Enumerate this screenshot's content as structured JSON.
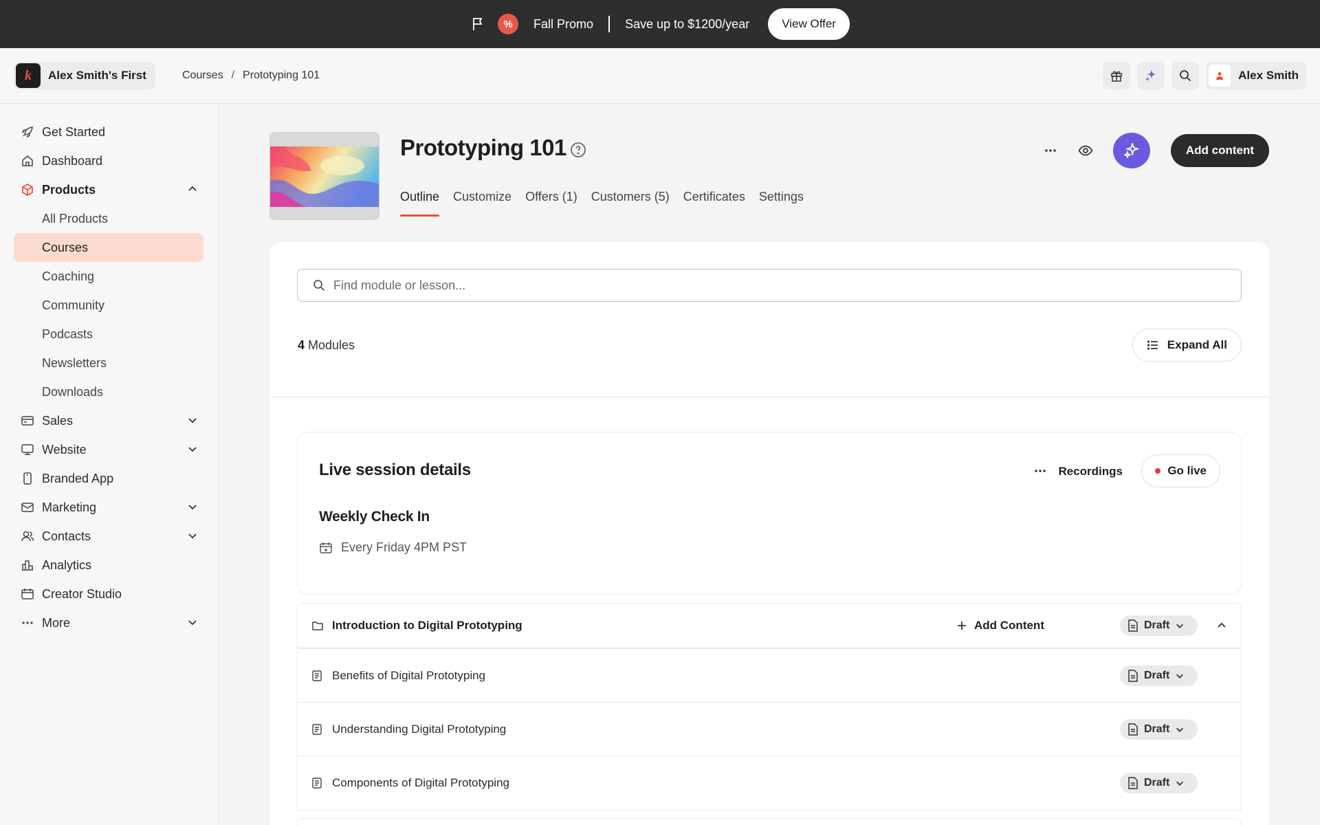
{
  "promo": {
    "title": "Fall Promo",
    "message": "Save up to $1200/year",
    "button": "View Offer",
    "badge_symbol": "%"
  },
  "header": {
    "workspace_name": "Alex Smith's First",
    "logo_letter": "k",
    "breadcrumb": [
      "Courses",
      "Prototyping 101"
    ],
    "breadcrumb_separator": "/",
    "user_name": "Alex Smith"
  },
  "sidebar": {
    "items": [
      {
        "label": "Get Started",
        "icon": "rocket-icon"
      },
      {
        "label": "Dashboard",
        "icon": "home-icon"
      },
      {
        "label": "Products",
        "icon": "box-icon",
        "expanded": true
      },
      {
        "label": "All Products"
      },
      {
        "label": "Courses",
        "selected": true
      },
      {
        "label": "Coaching"
      },
      {
        "label": "Community"
      },
      {
        "label": "Podcasts"
      },
      {
        "label": "Newsletters"
      },
      {
        "label": "Downloads"
      },
      {
        "label": "Sales",
        "icon": "credit-card-icon"
      },
      {
        "label": "Website",
        "icon": "monitor-icon"
      },
      {
        "label": "Branded App",
        "icon": "phone-icon"
      },
      {
        "label": "Marketing",
        "icon": "mail-icon"
      },
      {
        "label": "Contacts",
        "icon": "users-icon"
      },
      {
        "label": "Analytics",
        "icon": "bar-chart-icon"
      },
      {
        "label": "Creator Studio",
        "icon": "calendar-icon"
      },
      {
        "label": "More",
        "icon": "dots-icon"
      }
    ]
  },
  "product": {
    "title": "Prototyping 101",
    "tabs": [
      "Outline",
      "Customize",
      "Offers (1)",
      "Customers (5)",
      "Certificates",
      "Settings"
    ],
    "active_tab": "Outline",
    "add_content_label": "Add content"
  },
  "outline": {
    "search_placeholder": "Find module or lesson...",
    "module_count": "4",
    "module_count_label": "Modules",
    "expand_all_label": "Expand All"
  },
  "live_session": {
    "heading": "Live session details",
    "recordings_label": "Recordings",
    "go_live_label": "Go live",
    "session_name": "Weekly Check In",
    "schedule": "Every Friday 4PM PST"
  },
  "modules": [
    {
      "title": "Introduction to Digital Prototyping",
      "add_content_label": "Add Content",
      "status": "Draft"
    }
  ],
  "lessons": [
    {
      "title": "Benefits of Digital Prototyping",
      "status": "Draft"
    },
    {
      "title": "Understanding Digital Prototyping",
      "status": "Draft"
    },
    {
      "title": "Components of Digital Prototyping",
      "status": "Draft"
    }
  ],
  "colors": {
    "accent": "#ef4b3a",
    "ai_purple": "#6a5ae0",
    "selected_nav_bg": "#fcdcd0",
    "promo_bg": "#2e2e2e"
  }
}
